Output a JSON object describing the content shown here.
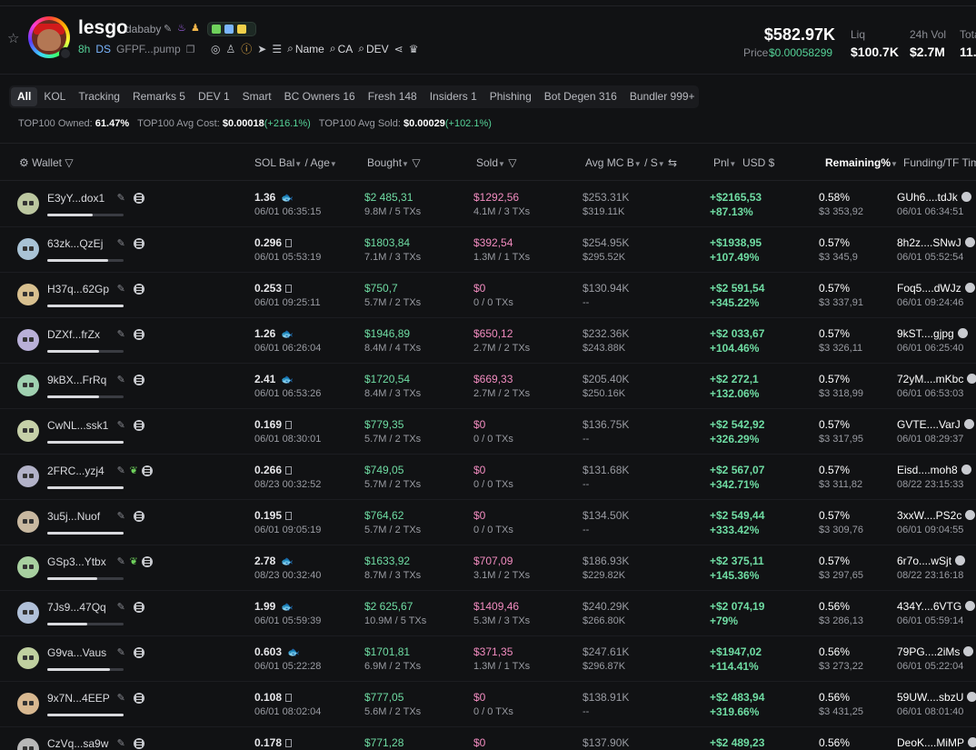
{
  "token": {
    "name": "lesgo",
    "ticker": "dababy",
    "age": "8h",
    "ds": "DS",
    "contract": "GFPF...pump",
    "search_name": "Name",
    "search_ca": "CA",
    "search_dev": "DEV",
    "market_cap": "$582.97K",
    "price_label": "Price",
    "price": "$0.00058299",
    "liq_label": "Liq",
    "liq": "$100.7K",
    "vol_label": "24h Vol",
    "vol": "$2.7M",
    "total_label": "Tota",
    "total": "11."
  },
  "tabs": [
    {
      "label": "All",
      "active": true
    },
    {
      "label": "KOL"
    },
    {
      "label": "Tracking"
    },
    {
      "label": "Remarks 5"
    },
    {
      "label": "DEV 1"
    },
    {
      "label": "Smart"
    },
    {
      "label": "BC Owners 16"
    },
    {
      "label": "Fresh 148"
    },
    {
      "label": "Insiders 1"
    },
    {
      "label": "Phishing"
    },
    {
      "label": "Bot Degen 316"
    },
    {
      "label": "Bundler 999+"
    }
  ],
  "summary": {
    "owned_label": "TOP100 Owned:",
    "owned": "61.47%",
    "avg_cost_label": "TOP100 Avg Cost:",
    "avg_cost": "$0.00018",
    "avg_cost_change": "(+216.1%)",
    "avg_sold_label": "TOP100 Avg Sold:",
    "avg_sold": "$0.00029",
    "avg_sold_change": "(+102.1%)"
  },
  "columns": {
    "wallet": "Wallet",
    "sol_bal": "SOL Bal",
    "age": "/ Age",
    "bought": "Bought",
    "sold": "Sold",
    "avg_mc": "Avg MC B",
    "avg_mc_s": "/ S",
    "pnl": "Pnl",
    "usd": "USD",
    "remaining": "Remaining%",
    "funding": "Funding/TF Tim"
  },
  "rows": [
    {
      "wallet": "E3yY...dox1",
      "leaf": false,
      "bar": 0.6,
      "sol": "1.36",
      "fish": true,
      "time": "06/01 06:35:15",
      "bought": "$2 485,31",
      "bought_sub": "9.8M / 5 TXs",
      "sold": "$1292,56",
      "sold_sub": "4.1M / 3 TXs",
      "mcb": "$253.31K",
      "mcs": "$319.11K",
      "pnl": "+$2165,53",
      "pnl_pct": "+87.13%",
      "rem": "0.58%",
      "rem_usd": "$3 353,92",
      "fund": "GUh6....tdJk",
      "fund_time": "06/01 06:34:51"
    },
    {
      "wallet": "63zk...QzEj",
      "leaf": false,
      "bar": 0.8,
      "sol": "0.296",
      "fish": false,
      "time": "06/01 05:53:19",
      "bought": "$1803,84",
      "bought_sub": "7.1M / 3 TXs",
      "sold": "$392,54",
      "sold_sub": "1.3M / 1 TXs",
      "mcb": "$254.95K",
      "mcs": "$295.52K",
      "pnl": "+$1938,95",
      "pnl_pct": "+107.49%",
      "rem": "0.57%",
      "rem_usd": "$3 345,9",
      "fund": "8h2z....SNwJ",
      "fund_time": "06/01 05:52:54"
    },
    {
      "wallet": "H37q...62Gp",
      "leaf": false,
      "bar": 1.0,
      "sol": "0.253",
      "fish": false,
      "time": "06/01 09:25:11",
      "bought": "$750,7",
      "bought_sub": "5.7M / 2 TXs",
      "sold": "$0",
      "sold_sub": "0 / 0 TXs",
      "mcb": "$130.94K",
      "mcs": "--",
      "pnl": "+$2 591,54",
      "pnl_pct": "+345.22%",
      "rem": "0.57%",
      "rem_usd": "$3 337,91",
      "fund": "Foq5....dWJz",
      "fund_time": "06/01 09:24:46"
    },
    {
      "wallet": "DZXf...frZx",
      "leaf": false,
      "bar": 0.68,
      "sol": "1.26",
      "fish": true,
      "time": "06/01 06:26:04",
      "bought": "$1946,89",
      "bought_sub": "8.4M / 4 TXs",
      "sold": "$650,12",
      "sold_sub": "2.7M / 2 TXs",
      "mcb": "$232.36K",
      "mcs": "$243.88K",
      "pnl": "+$2 033,67",
      "pnl_pct": "+104.46%",
      "rem": "0.57%",
      "rem_usd": "$3 326,11",
      "fund": "9kST....gjpg",
      "fund_time": "06/01 06:25:40"
    },
    {
      "wallet": "9kBX...FrRq",
      "leaf": false,
      "bar": 0.68,
      "sol": "2.41",
      "fish": true,
      "time": "06/01 06:53:26",
      "bought": "$1720,54",
      "bought_sub": "8.4M / 3 TXs",
      "sold": "$669,33",
      "sold_sub": "2.7M / 2 TXs",
      "mcb": "$205.40K",
      "mcs": "$250.16K",
      "pnl": "+$2 272,1",
      "pnl_pct": "+132.06%",
      "rem": "0.57%",
      "rem_usd": "$3 318,99",
      "fund": "72yM....mKbc",
      "fund_time": "06/01 06:53:03"
    },
    {
      "wallet": "CwNL...ssk1",
      "leaf": false,
      "bar": 1.0,
      "sol": "0.169",
      "fish": false,
      "time": "06/01 08:30:01",
      "bought": "$779,35",
      "bought_sub": "5.7M / 2 TXs",
      "sold": "$0",
      "sold_sub": "0 / 0 TXs",
      "mcb": "$136.75K",
      "mcs": "--",
      "pnl": "+$2 542,92",
      "pnl_pct": "+326.29%",
      "rem": "0.57%",
      "rem_usd": "$3 317,95",
      "fund": "GVTE....VarJ",
      "fund_time": "06/01 08:29:37"
    },
    {
      "wallet": "2FRC...yzj4",
      "leaf": true,
      "bar": 1.0,
      "sol": "0.266",
      "fish": false,
      "time": "08/23 00:32:52",
      "bought": "$749,05",
      "bought_sub": "5.7M / 2 TXs",
      "sold": "$0",
      "sold_sub": "0 / 0 TXs",
      "mcb": "$131.68K",
      "mcs": "--",
      "pnl": "+$2 567,07",
      "pnl_pct": "+342.71%",
      "rem": "0.57%",
      "rem_usd": "$3 311,82",
      "fund": "Eisd....moh8",
      "fund_time": "08/22 23:15:33"
    },
    {
      "wallet": "3u5j...Nuof",
      "leaf": false,
      "bar": 1.0,
      "sol": "0.195",
      "fish": false,
      "time": "06/01 09:05:19",
      "bought": "$764,62",
      "bought_sub": "5.7M / 2 TXs",
      "sold": "$0",
      "sold_sub": "0 / 0 TXs",
      "mcb": "$134.50K",
      "mcs": "--",
      "pnl": "+$2 549,44",
      "pnl_pct": "+333.42%",
      "rem": "0.57%",
      "rem_usd": "$3 309,76",
      "fund": "3xxW....PS2c",
      "fund_time": "06/01 09:04:55"
    },
    {
      "wallet": "GSp3...Ytbx",
      "leaf": true,
      "bar": 0.65,
      "sol": "2.78",
      "fish": true,
      "time": "08/23 00:32:40",
      "bought": "$1633,92",
      "bought_sub": "8.7M / 3 TXs",
      "sold": "$707,09",
      "sold_sub": "3.1M / 2 TXs",
      "mcb": "$186.93K",
      "mcs": "$229.82K",
      "pnl": "+$2 375,11",
      "pnl_pct": "+145.36%",
      "rem": "0.57%",
      "rem_usd": "$3 297,65",
      "fund": "6r7o....wSjt",
      "fund_time": "08/22 23:16:18"
    },
    {
      "wallet": "7Js9...47Qq",
      "leaf": false,
      "bar": 0.52,
      "sol": "1.99",
      "fish": true,
      "time": "06/01 05:59:39",
      "bought": "$2 625,67",
      "bought_sub": "10.9M / 5 TXs",
      "sold": "$1409,46",
      "sold_sub": "5.3M / 3 TXs",
      "mcb": "$240.29K",
      "mcs": "$266.80K",
      "pnl": "+$2 074,19",
      "pnl_pct": "+79%",
      "rem": "0.56%",
      "rem_usd": "$3 286,13",
      "fund": "434Y....6VTG",
      "fund_time": "06/01 05:59:14"
    },
    {
      "wallet": "G9va...Vaus",
      "leaf": false,
      "bar": 0.82,
      "sol": "0.603",
      "fish": true,
      "time": "06/01 05:22:28",
      "bought": "$1701,81",
      "bought_sub": "6.9M / 2 TXs",
      "sold": "$371,35",
      "sold_sub": "1.3M / 1 TXs",
      "mcb": "$247.61K",
      "mcs": "$296.87K",
      "pnl": "+$1947,02",
      "pnl_pct": "+114.41%",
      "rem": "0.56%",
      "rem_usd": "$3 273,22",
      "fund": "79PG....2iMs",
      "fund_time": "06/01 05:22:04"
    },
    {
      "wallet": "9x7N...4EEP",
      "leaf": false,
      "bar": 1.0,
      "sol": "0.108",
      "fish": false,
      "time": "06/01 08:02:04",
      "bought": "$777,05",
      "bought_sub": "5.6M / 2 TXs",
      "sold": "$0",
      "sold_sub": "0 / 0 TXs",
      "mcb": "$138.91K",
      "mcs": "--",
      "pnl": "+$2 483,94",
      "pnl_pct": "+319.66%",
      "rem": "0.56%",
      "rem_usd": "$3 431,25",
      "fund": "59UW....sbzU",
      "fund_time": "06/01 08:01:40"
    },
    {
      "wallet": "CzVq...sa9w",
      "leaf": false,
      "bar": 1.0,
      "sol": "0.178",
      "fish": false,
      "time": "",
      "bought": "$771,28",
      "bought_sub": "",
      "sold": "$0",
      "sold_sub": "",
      "mcb": "$137.90K",
      "mcs": "",
      "pnl": "+$2 489,23",
      "pnl_pct": "",
      "rem": "0.56%",
      "rem_usd": "",
      "fund": "DeoK....MiMP",
      "fund_time": ""
    }
  ],
  "colors": {
    "accent_green": "#6fdca3",
    "sold_pink": "#f28cc0",
    "background": "#111214"
  }
}
